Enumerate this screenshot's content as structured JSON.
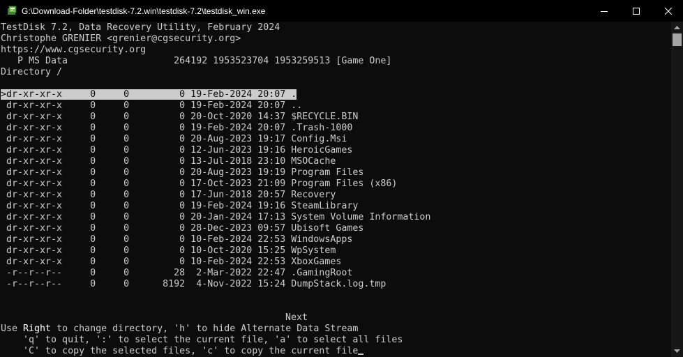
{
  "window": {
    "title": "G:\\Download-Folder\\testdisk-7.2.win\\testdisk-7.2\\testdisk_win.exe",
    "icon": "console-app-icon"
  },
  "header": {
    "line1": "TestDisk 7.2, Data Recovery Utility, February 2024",
    "line2": "Christophe GRENIER <grenier@cgsecurity.org>",
    "line3": "https://www.cgsecurity.org",
    "partition": "   P MS Data                   264192 1953523704 1953259513 [Game One]",
    "directory": "Directory /"
  },
  "listing": {
    "selected_index": 0,
    "rows": [
      ">dr-xr-xr-x     0     0         0 19-Feb-2024 20:07 .",
      " dr-xr-xr-x     0     0         0 19-Feb-2024 20:07 ..",
      " dr-xr-xr-x     0     0         0 20-Oct-2020 14:37 $RECYCLE.BIN",
      " dr-xr-xr-x     0     0         0 19-Feb-2024 20:07 .Trash-1000",
      " dr-xr-xr-x     0     0         0 20-Aug-2023 19:17 Config.Msi",
      " dr-xr-xr-x     0     0         0 12-Jun-2023 19:16 HeroicGames",
      " dr-xr-xr-x     0     0         0 13-Jul-2018 23:10 MSOCache",
      " dr-xr-xr-x     0     0         0 20-Aug-2023 19:19 Program Files",
      " dr-xr-xr-x     0     0         0 17-Oct-2023 21:09 Program Files (x86)",
      " dr-xr-xr-x     0     0         0 17-Jun-2018 20:57 Recovery",
      " dr-xr-xr-x     0     0         0 19-Feb-2024 19:16 SteamLibrary",
      " dr-xr-xr-x     0     0         0 20-Jan-2024 17:13 System Volume Information",
      " dr-xr-xr-x     0     0         0 28-Dec-2023 09:57 Ubisoft Games",
      " dr-xr-xr-x     0     0         0 10-Feb-2024 22:53 WindowsApps",
      " dr-xr-xr-x     0     0         0 10-Oct-2020 15:25 WpSystem",
      " dr-xr-xr-x     0     0         0 10-Feb-2024 22:53 XboxGames",
      " -r--r--r--     0     0        28  2-Mar-2022 22:47 .GamingRoot",
      " -r--r--r--     0     0      8192  4-Nov-2022 15:24 DumpStack.log.tmp"
    ]
  },
  "footer": {
    "next": "Next",
    "help1_pre": "Use ",
    "help1_key": "Right",
    "help1_post": " to change directory, 'h' to hide Alternate Data Stream",
    "help2": "    'q' to quit, ':' to select the current file, 'a' to select all files",
    "help3": "    'C' to copy the selected files, 'c' to copy the current file"
  },
  "colors": {
    "background": "#0c0c0c",
    "text": "#cccccc",
    "highlight": "#cccccc",
    "bold": "#ffffff",
    "titlebar": "#000000"
  }
}
